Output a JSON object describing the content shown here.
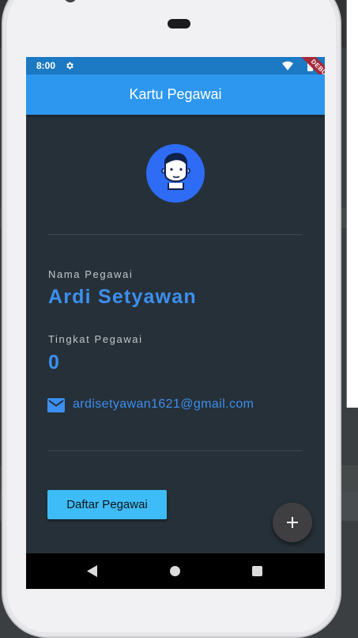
{
  "status_bar": {
    "time": "8:00",
    "debug_banner": "DEBUG"
  },
  "app_bar": {
    "title": "Kartu Pegawai"
  },
  "profile": {
    "name_label": "Nama Pegawai",
    "name": "Ardi Setyawan",
    "level_label": "Tingkat Pegawai",
    "level": "0",
    "email": "ardisetyawan1621@gmail.com"
  },
  "actions": {
    "list_button": "Daftar Pegawai",
    "fab_icon": "add-icon"
  },
  "icons": {
    "status": [
      "gear-icon",
      "wifi-icon",
      "battery-icon"
    ],
    "email": "mail-icon",
    "nav": [
      "back-icon",
      "home-icon",
      "recents-icon"
    ]
  },
  "colors": {
    "app_bar": "#2d97f0",
    "status_bar": "#1c79c4",
    "background": "#263038",
    "accent_text": "#3c8ff0",
    "avatar": "#2e6cf6",
    "button": "#3dbcf7",
    "fab": "#3f3f41"
  }
}
